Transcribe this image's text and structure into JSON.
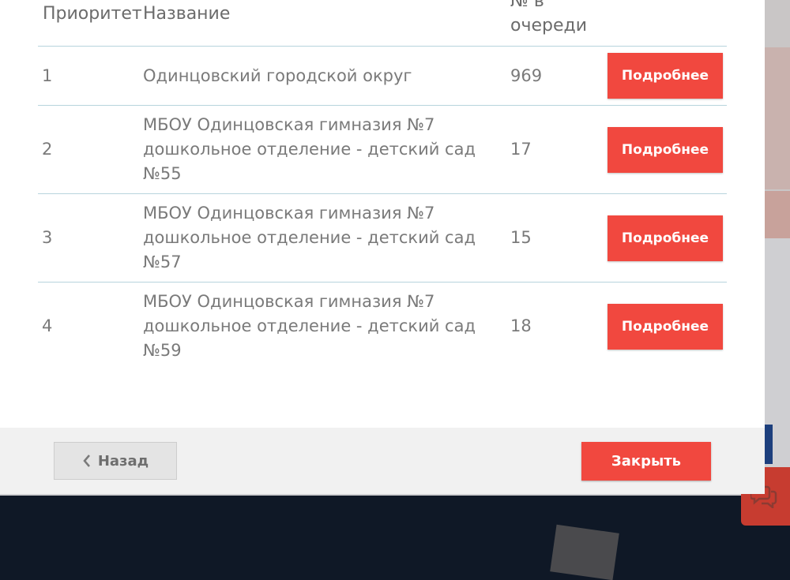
{
  "table": {
    "headers": {
      "priority": "Приоритет",
      "name": "Название",
      "queue": "№ в очереди"
    },
    "rows": [
      {
        "priority": "1",
        "name": "Одинцовский городской округ",
        "queue": "969",
        "button": "Подробнее"
      },
      {
        "priority": "2",
        "name": "МБОУ Одинцовская гимназия №7 дошкольное отделение - детский сад №55",
        "queue": "17",
        "button": "Подробнее"
      },
      {
        "priority": "3",
        "name": "МБОУ Одинцовская гимназия №7 дошкольное отделение - детский сад №57",
        "queue": "15",
        "button": "Подробнее"
      },
      {
        "priority": "4",
        "name": "МБОУ Одинцовская гимназия №7 дошкольное отделение - детский сад №59",
        "queue": "18",
        "button": "Подробнее"
      }
    ]
  },
  "footer": {
    "back_label": "Назад",
    "close_label": "Закрыть"
  },
  "colors": {
    "accent": "#f1483f",
    "divider": "#b7d4dd",
    "footer_bg": "#f1f1f1",
    "page_dark": "#0f1826"
  },
  "icons": {
    "back": "chevron-left-icon",
    "chat": "chat-bubbles-icon"
  }
}
